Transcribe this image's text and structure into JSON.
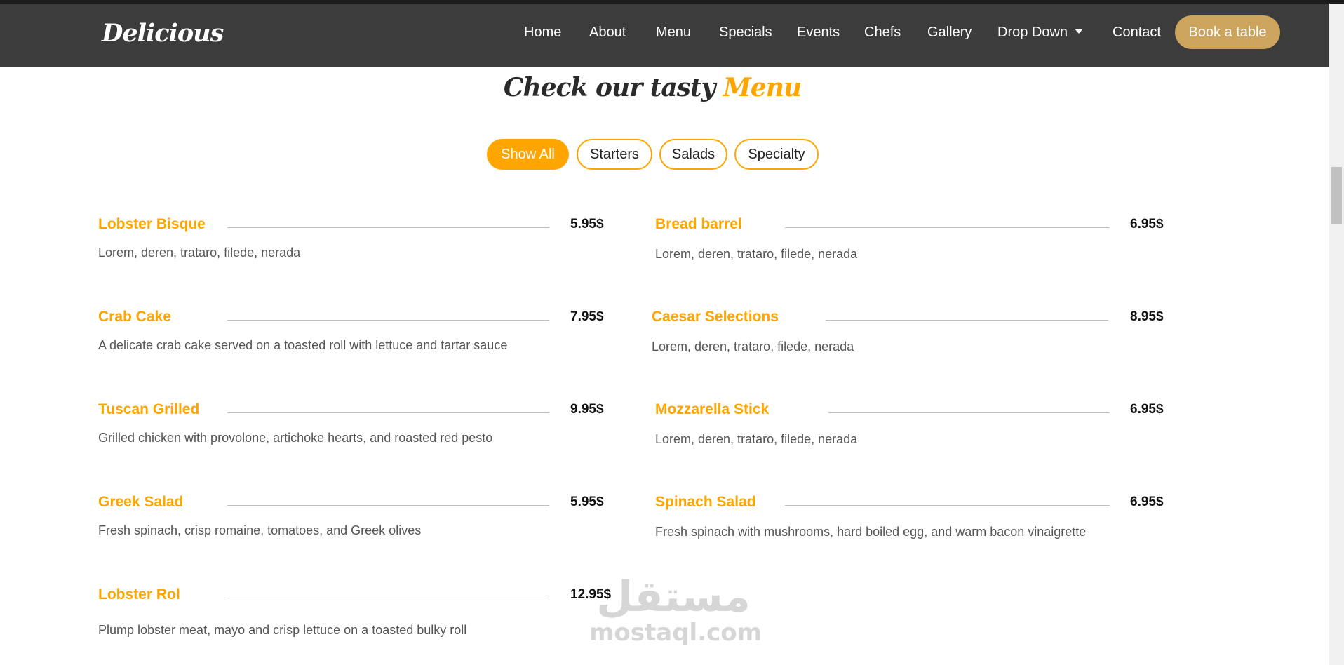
{
  "navbar": {
    "brand": "Delicious",
    "links": [
      {
        "label": "Home"
      },
      {
        "label": "About"
      },
      {
        "label": "Menu"
      },
      {
        "label": "Specials"
      },
      {
        "label": "Events"
      },
      {
        "label": "Chefs"
      },
      {
        "label": "Gallery"
      },
      {
        "label": "Drop Down"
      },
      {
        "label": "Contact"
      }
    ],
    "cta": "Book a table"
  },
  "section": {
    "title_prefix": "Check our tasty",
    "title_accent": "Menu"
  },
  "filters": [
    {
      "label": "Show All",
      "active": true
    },
    {
      "label": "Starters",
      "active": false
    },
    {
      "label": "Salads",
      "active": false
    },
    {
      "label": "Specialty",
      "active": false
    }
  ],
  "menu_items": [
    {
      "name": "Lobster Bisque",
      "price": "5.95$",
      "desc": "Lorem, deren, trataro, filede, nerada"
    },
    {
      "name": "Bread barrel",
      "price": "6.95$",
      "desc": "Lorem, deren, trataro, filede, nerada"
    },
    {
      "name": "Crab Cake",
      "price": "7.95$",
      "desc": "A delicate crab cake served on a toasted roll with lettuce and tartar sauce"
    },
    {
      "name": "Caesar Selections",
      "price": "8.95$",
      "desc": "Lorem, deren, trataro, filede, nerada"
    },
    {
      "name": "Tuscan Grilled",
      "price": "9.95$",
      "desc": "Grilled chicken with provolone, artichoke hearts, and roasted red pesto"
    },
    {
      "name": "Mozzarella Stick",
      "price": "6.95$",
      "desc": "Lorem, deren, trataro, filede, nerada"
    },
    {
      "name": "Greek Salad",
      "price": "5.95$",
      "desc": "Fresh spinach, crisp romaine, tomatoes, and Greek olives"
    },
    {
      "name": "Spinach Salad",
      "price": "6.95$",
      "desc": "Fresh spinach with mushrooms, hard boiled egg, and warm bacon vinaigrette"
    },
    {
      "name": "Lobster Rol",
      "price": "12.95$",
      "desc": "Plump lobster meat, mayo and crisp lettuce on a toasted bulky roll"
    }
  ],
  "watermark": {
    "arabic": "مستقل",
    "latin": "mostaql.com"
  },
  "colors": {
    "accent": "#ffa500",
    "navbar": "#3c3c3c",
    "cta": "#cda45e"
  }
}
